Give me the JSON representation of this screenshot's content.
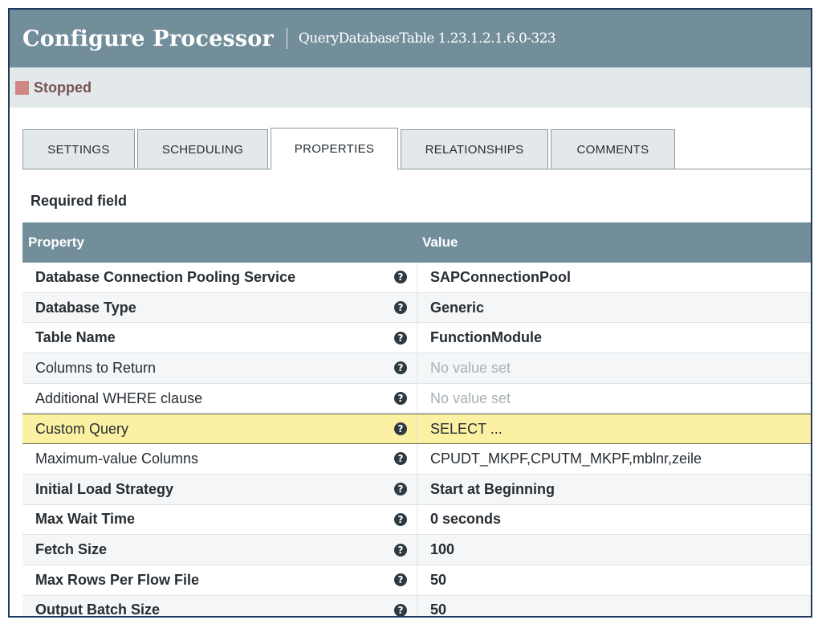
{
  "header": {
    "title": "Configure Processor",
    "subtitle": "QueryDatabaseTable 1.23.1.2.1.6.0-323"
  },
  "status": {
    "label": "Stopped",
    "color": "#d18686"
  },
  "tabs": [
    {
      "label": "SETTINGS",
      "active": false
    },
    {
      "label": "SCHEDULING",
      "active": false
    },
    {
      "label": "PROPERTIES",
      "active": true
    },
    {
      "label": "RELATIONSHIPS",
      "active": false
    },
    {
      "label": "COMMENTS",
      "active": false
    }
  ],
  "required_field_label": "Required field",
  "table": {
    "columns": {
      "property": "Property",
      "value": "Value"
    },
    "rows": [
      {
        "name": "Database Connection Pooling Service",
        "value": "SAPConnectionPool"
      },
      {
        "name": "Database Type",
        "value": "Generic"
      },
      {
        "name": "Table Name",
        "value": "FunctionModule"
      },
      {
        "name": "Columns to Return",
        "value": "No value set"
      },
      {
        "name": "Additional WHERE clause",
        "value": "No value set"
      },
      {
        "name": "Custom Query",
        "value": "SELECT ..."
      },
      {
        "name": "Maximum-value Columns",
        "value": "CPUDT_MKPF,CPUTM_MKPF,mblnr,zeile"
      },
      {
        "name": "Initial Load Strategy",
        "value": "Start at Beginning"
      },
      {
        "name": "Max Wait Time",
        "value": "0 seconds"
      },
      {
        "name": "Fetch Size",
        "value": "100"
      },
      {
        "name": "Max Rows Per Flow File",
        "value": "50"
      },
      {
        "name": "Output Batch Size",
        "value": "50"
      }
    ]
  },
  "colors": {
    "header_bg": "#728e9b",
    "status_bg": "#e3e8eb",
    "highlight_row": "#fcf0a2",
    "help_icon": "#2f3a40"
  },
  "icons": {
    "help": "question-circle-icon"
  }
}
